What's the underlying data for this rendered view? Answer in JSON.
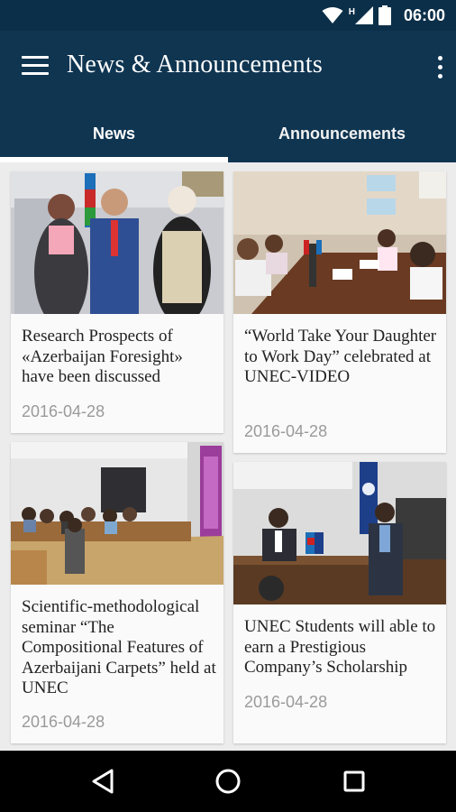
{
  "status_bar": {
    "time": "06:00",
    "network_badge": "H",
    "icons": [
      "wifi-icon",
      "signal-icon",
      "battery-icon"
    ]
  },
  "app_bar": {
    "title": "News & Announcements",
    "menu_icon": "hamburger-menu-icon",
    "overflow_icon": "more-vertical-icon"
  },
  "tabs": [
    {
      "label": "News",
      "selected": true
    },
    {
      "label": "Announcements",
      "selected": false
    }
  ],
  "news": [
    {
      "title": "Research Prospects of «Azerbaijan Foresight» have been discussed",
      "date": "2016-04-28",
      "image": "photo-officials-with-flag"
    },
    {
      "title": "“World Take Your Daughter to Work Day” celebrated at UNEC-VIDEO",
      "date": "2016-04-28",
      "image": "photo-children-at-meeting-table"
    },
    {
      "title": "Scientific-methodological seminar “The Compositional Features of Azerbaijani Carpets” held at UNEC",
      "date": "2016-04-28",
      "image": "photo-seminar-audience"
    },
    {
      "title": "UNEC Students will able to earn a Prestigious Company’s Scholarship",
      "date": "2016-04-28",
      "image": "photo-speakers-at-panel"
    }
  ],
  "nav_bar": {
    "buttons": [
      "back-icon",
      "home-icon",
      "recents-icon"
    ]
  },
  "colors": {
    "status_bar": "#0b2f48",
    "app_bar": "#0f3551",
    "tab_indicator": "#ffffff",
    "date_text": "#9a9a9a"
  }
}
